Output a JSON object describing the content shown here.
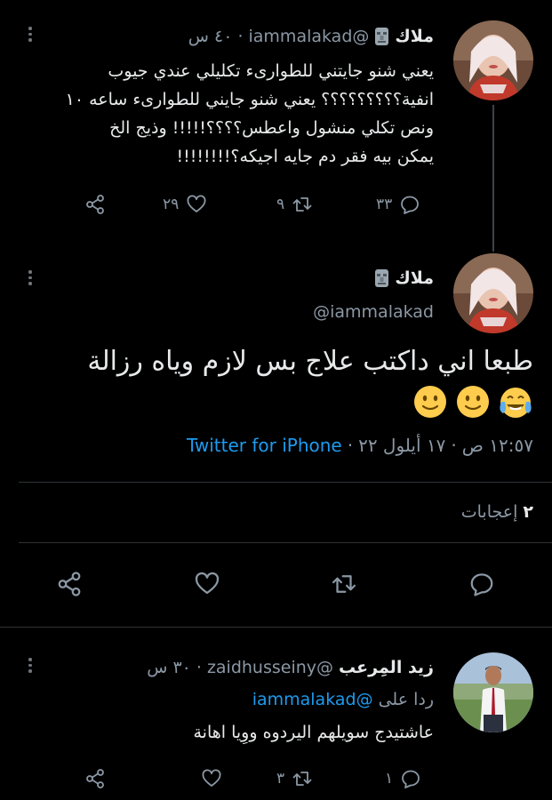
{
  "tweet1": {
    "name": "ملاك",
    "handle": "@iammalakad",
    "time": "٤٠ س",
    "text_lines": [
      "يعني شنو جايتني للطوارىء تكليلي عندي جيوب",
      "انفية؟؟؟؟؟؟؟؟؟ يعني شنو جايني للطوارىء ساعه ١٠",
      "ونص تكلي منشول واعطس؟؟؟؟!!!!! وذيج الخ",
      "يمكن بيه فقر دم جايه اجيكه؟!!!!!!!!"
    ],
    "replies": "٣٣",
    "retweets": "٩",
    "likes": "٢٩"
  },
  "tweet2": {
    "name": "ملاك",
    "handle": "@iammalakad",
    "text": "طبعا اني داكتب علاج بس لازم وياه رزالة",
    "emoji_icons": [
      "face-with-tears-of-joy",
      "slightly-smiling-face",
      "slightly-smiling-face"
    ],
    "meta_time": "١٢:٥٧ ص",
    "meta_sep1": "·",
    "meta_date": "١٧ أيلول ٢٢",
    "meta_sep2": "·",
    "source": "Twitter for iPhone",
    "reply_count_label": "إعجابات",
    "reply_count_num": "٢"
  },
  "tweet3": {
    "name": "زيد المِرعب",
    "handle": "@zaidhusseiny",
    "time": "٣٠ س",
    "replying_prefix": "ردا على",
    "replying_to": "@iammalakad",
    "text": "عاشتيدج سويلهم اليردوه ووِيا اهانة",
    "replies": "١",
    "retweets": "٣",
    "likes": ""
  },
  "colors": {
    "background": "#000000",
    "text": "#e7e9ea",
    "muted": "#8b98a5",
    "link": "#1d9bf0",
    "divider": "#2f3336"
  }
}
